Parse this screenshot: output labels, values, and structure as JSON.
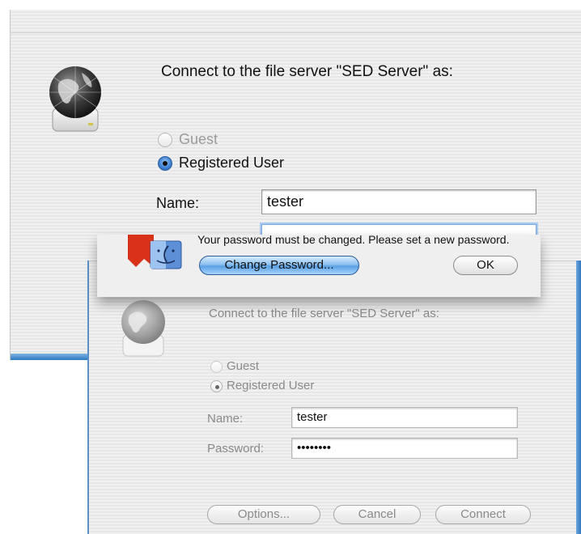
{
  "back_dialog": {
    "prompt": "Connect to the file server \"SED Server\" as:",
    "guest_label": "Guest",
    "registered_label": "Registered User",
    "name_label": "Name:",
    "name_value": "tester"
  },
  "alert": {
    "message": "Your password must be changed. Please set a new password.",
    "change_password_label": "Change Password...",
    "ok_label": "OK"
  },
  "front_dialog": {
    "prompt": "Connect to the file server \"SED Server\" as:",
    "guest_label": "Guest",
    "registered_label": "Registered User",
    "name_label": "Name:",
    "name_value": "tester",
    "password_label": "Password:",
    "password_value": "••••••••",
    "options_label": "Options...",
    "cancel_label": "Cancel",
    "connect_label": "Connect"
  }
}
